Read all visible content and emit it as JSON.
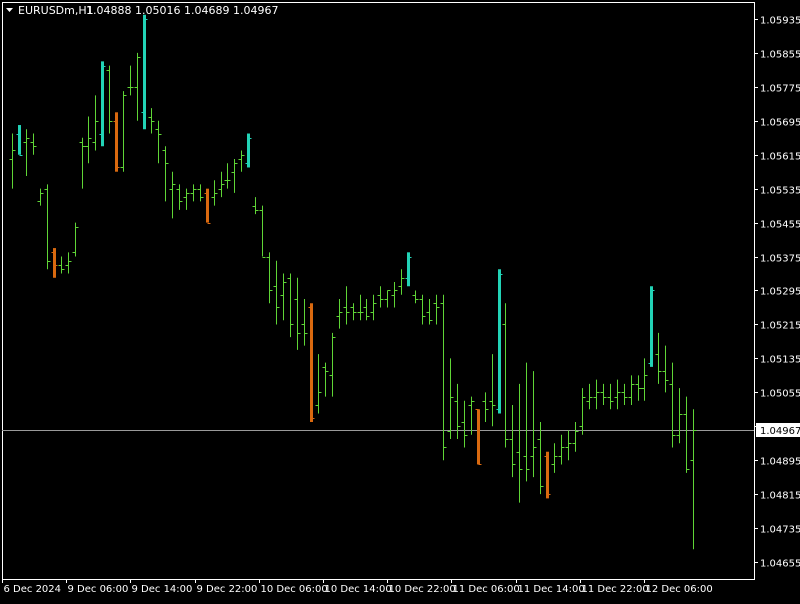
{
  "header": {
    "symbol": "EURUSDm,H1",
    "ohlc": "1.04888 1.05016 1.04689 1.04967"
  },
  "colors": {
    "background": "#000000",
    "frame": "#ffffff",
    "bar_normal": "#5fd536",
    "bar_up_highlight": "#22d3b6",
    "bar_down_highlight": "#d9690f",
    "bid_line": "#9a9a9a",
    "bid_label_bg": "#ffffff"
  },
  "chart_data": {
    "type": "ohlc-bar",
    "symbol": "EURUSDm",
    "timeframe": "H1",
    "ylim": [
      1.04615,
      1.05975
    ],
    "y_ticks": [
      "1.05935",
      "1.05855",
      "1.05775",
      "1.05695",
      "1.05615",
      "1.05535",
      "1.05455",
      "1.05375",
      "1.05295",
      "1.05215",
      "1.05135",
      "1.05055",
      "1.04975",
      "1.04895",
      "1.04815",
      "1.04735",
      "1.04655"
    ],
    "x_ticks": [
      "6 Dec 2024",
      "9 Dec 06:00",
      "9 Dec 14:00",
      "9 Dec 22:00",
      "10 Dec 06:00",
      "10 Dec 14:00",
      "10 Dec 22:00",
      "11 Dec 06:00",
      "11 Dec 14:00",
      "11 Dec 22:00",
      "12 Dec 06:00"
    ],
    "bid": "1.04967",
    "bars": [
      {
        "o": 1.05605,
        "h": 1.05665,
        "l": 1.05535,
        "c": 1.05625,
        "hl": 0
      },
      {
        "o": 1.05665,
        "h": 1.05685,
        "l": 1.05615,
        "c": 1.05615,
        "hl": 1
      },
      {
        "o": 1.05645,
        "h": 1.05675,
        "l": 1.05565,
        "c": 1.05655,
        "hl": 0
      },
      {
        "o": 1.05645,
        "h": 1.05665,
        "l": 1.05615,
        "c": 1.05635,
        "hl": 0
      },
      {
        "o": 1.05505,
        "h": 1.05535,
        "l": 1.05495,
        "c": 1.05525,
        "hl": 0
      },
      {
        "o": 1.05535,
        "h": 1.05545,
        "l": 1.05345,
        "c": 1.05365,
        "hl": 0
      },
      {
        "o": 1.05385,
        "h": 1.05395,
        "l": 1.05325,
        "c": 1.05355,
        "hl": 2
      },
      {
        "o": 1.05355,
        "h": 1.05375,
        "l": 1.05335,
        "c": 1.05345,
        "hl": 0
      },
      {
        "o": 1.05355,
        "h": 1.05385,
        "l": 1.05335,
        "c": 1.05365,
        "hl": 0
      },
      {
        "o": 1.05385,
        "h": 1.05455,
        "l": 1.05375,
        "c": 1.05445,
        "hl": 0
      },
      {
        "o": 1.05645,
        "h": 1.05655,
        "l": 1.05535,
        "c": 1.05635,
        "hl": 0
      },
      {
        "o": 1.05635,
        "h": 1.05705,
        "l": 1.05595,
        "c": 1.05655,
        "hl": 0
      },
      {
        "o": 1.05645,
        "h": 1.05755,
        "l": 1.05625,
        "c": 1.05695,
        "hl": 0
      },
      {
        "o": 1.05665,
        "h": 1.05835,
        "l": 1.05635,
        "c": 1.05825,
        "hl": 1
      },
      {
        "o": 1.05815,
        "h": 1.05825,
        "l": 1.05665,
        "c": 1.05695,
        "hl": 0
      },
      {
        "o": 1.05695,
        "h": 1.05715,
        "l": 1.05575,
        "c": 1.05585,
        "hl": 2
      },
      {
        "o": 1.05585,
        "h": 1.05765,
        "l": 1.05575,
        "c": 1.05755,
        "hl": 0
      },
      {
        "o": 1.05775,
        "h": 1.05825,
        "l": 1.05755,
        "c": 1.05775,
        "hl": 0
      },
      {
        "o": 1.05775,
        "h": 1.05855,
        "l": 1.05695,
        "c": 1.05845,
        "hl": 0
      },
      {
        "o": 1.05715,
        "h": 1.05945,
        "l": 1.05675,
        "c": 1.05935,
        "hl": 1
      },
      {
        "o": 1.05705,
        "h": 1.05725,
        "l": 1.05665,
        "c": 1.05695,
        "hl": 0
      },
      {
        "o": 1.05675,
        "h": 1.05695,
        "l": 1.05595,
        "c": 1.05665,
        "hl": 0
      },
      {
        "o": 1.05625,
        "h": 1.05635,
        "l": 1.05505,
        "c": 1.05595,
        "hl": 0
      },
      {
        "o": 1.05535,
        "h": 1.05575,
        "l": 1.05465,
        "c": 1.05545,
        "hl": 0
      },
      {
        "o": 1.05535,
        "h": 1.05545,
        "l": 1.05485,
        "c": 1.05505,
        "hl": 0
      },
      {
        "o": 1.05515,
        "h": 1.05535,
        "l": 1.05485,
        "c": 1.05525,
        "hl": 0
      },
      {
        "o": 1.05525,
        "h": 1.05545,
        "l": 1.05505,
        "c": 1.05535,
        "hl": 0
      },
      {
        "o": 1.05535,
        "h": 1.05545,
        "l": 1.05505,
        "c": 1.05515,
        "hl": 0
      },
      {
        "o": 1.05525,
        "h": 1.05535,
        "l": 1.05455,
        "c": 1.05455,
        "hl": 2
      },
      {
        "o": 1.05515,
        "h": 1.05555,
        "l": 1.05495,
        "c": 1.05525,
        "hl": 0
      },
      {
        "o": 1.05535,
        "h": 1.05575,
        "l": 1.05515,
        "c": 1.05545,
        "hl": 0
      },
      {
        "o": 1.05555,
        "h": 1.05595,
        "l": 1.05535,
        "c": 1.05555,
        "hl": 0
      },
      {
        "o": 1.05575,
        "h": 1.05605,
        "l": 1.05525,
        "c": 1.05595,
        "hl": 0
      },
      {
        "o": 1.05605,
        "h": 1.05625,
        "l": 1.05575,
        "c": 1.05615,
        "hl": 0
      },
      {
        "o": 1.05595,
        "h": 1.05665,
        "l": 1.05585,
        "c": 1.05655,
        "hl": 1
      },
      {
        "o": 1.05495,
        "h": 1.05515,
        "l": 1.05475,
        "c": 1.05485,
        "hl": 0
      },
      {
        "o": 1.05485,
        "h": 1.05495,
        "l": 1.05375,
        "c": 1.05375,
        "hl": 0
      },
      {
        "o": 1.05375,
        "h": 1.05385,
        "l": 1.05265,
        "c": 1.05295,
        "hl": 0
      },
      {
        "o": 1.05305,
        "h": 1.05365,
        "l": 1.05215,
        "c": 1.05255,
        "hl": 0
      },
      {
        "o": 1.05285,
        "h": 1.05335,
        "l": 1.05225,
        "c": 1.05315,
        "hl": 0
      },
      {
        "o": 1.05325,
        "h": 1.05335,
        "l": 1.05185,
        "c": 1.05215,
        "hl": 0
      },
      {
        "o": 1.05275,
        "h": 1.05325,
        "l": 1.05155,
        "c": 1.05195,
        "hl": 0
      },
      {
        "o": 1.05215,
        "h": 1.05275,
        "l": 1.05165,
        "c": 1.05195,
        "hl": 0
      },
      {
        "o": 1.05255,
        "h": 1.05265,
        "l": 1.04985,
        "c": 1.04995,
        "hl": 2
      },
      {
        "o": 1.05025,
        "h": 1.05145,
        "l": 1.05005,
        "c": 1.05055,
        "hl": 0
      },
      {
        "o": 1.05115,
        "h": 1.05125,
        "l": 1.05045,
        "c": 1.05105,
        "hl": 0
      },
      {
        "o": 1.05095,
        "h": 1.05195,
        "l": 1.05045,
        "c": 1.05185,
        "hl": 0
      },
      {
        "o": 1.05235,
        "h": 1.05275,
        "l": 1.05205,
        "c": 1.05245,
        "hl": 0
      },
      {
        "o": 1.05255,
        "h": 1.05305,
        "l": 1.05215,
        "c": 1.05245,
        "hl": 0
      },
      {
        "o": 1.05255,
        "h": 1.05265,
        "l": 1.05225,
        "c": 1.05245,
        "hl": 0
      },
      {
        "o": 1.05245,
        "h": 1.05285,
        "l": 1.05225,
        "c": 1.05245,
        "hl": 0
      },
      {
        "o": 1.05255,
        "h": 1.05275,
        "l": 1.05225,
        "c": 1.05235,
        "hl": 0
      },
      {
        "o": 1.05245,
        "h": 1.05285,
        "l": 1.05225,
        "c": 1.05265,
        "hl": 0
      },
      {
        "o": 1.05285,
        "h": 1.05305,
        "l": 1.05255,
        "c": 1.05275,
        "hl": 0
      },
      {
        "o": 1.05275,
        "h": 1.05295,
        "l": 1.05255,
        "c": 1.05295,
        "hl": 0
      },
      {
        "o": 1.05285,
        "h": 1.05315,
        "l": 1.05255,
        "c": 1.05295,
        "hl": 0
      },
      {
        "o": 1.05305,
        "h": 1.05345,
        "l": 1.05285,
        "c": 1.05325,
        "hl": 0
      },
      {
        "o": 1.05325,
        "h": 1.05385,
        "l": 1.05305,
        "c": 1.05375,
        "hl": 1
      },
      {
        "o": 1.05285,
        "h": 1.05295,
        "l": 1.05265,
        "c": 1.05275,
        "hl": 0
      },
      {
        "o": 1.05275,
        "h": 1.05285,
        "l": 1.05215,
        "c": 1.05235,
        "hl": 0
      },
      {
        "o": 1.05245,
        "h": 1.05275,
        "l": 1.05215,
        "c": 1.05225,
        "hl": 0
      },
      {
        "o": 1.05265,
        "h": 1.05285,
        "l": 1.05215,
        "c": 1.05255,
        "hl": 0
      },
      {
        "o": 1.05265,
        "h": 1.05285,
        "l": 1.04895,
        "c": 1.04925,
        "hl": 0
      },
      {
        "o": 1.04965,
        "h": 1.05135,
        "l": 1.04945,
        "c": 1.05045,
        "hl": 0
      },
      {
        "o": 1.05035,
        "h": 1.05075,
        "l": 1.04945,
        "c": 1.04975,
        "hl": 0
      },
      {
        "o": 1.04985,
        "h": 1.05035,
        "l": 1.04925,
        "c": 1.04955,
        "hl": 0
      },
      {
        "o": 1.05025,
        "h": 1.05045,
        "l": 1.04955,
        "c": 1.05035,
        "hl": 0
      },
      {
        "o": 1.05015,
        "h": 1.05015,
        "l": 1.04885,
        "c": 1.04885,
        "hl": 2
      },
      {
        "o": 1.05035,
        "h": 1.05055,
        "l": 1.04985,
        "c": 1.05015,
        "hl": 0
      },
      {
        "o": 1.05035,
        "h": 1.05145,
        "l": 1.04975,
        "c": 1.05025,
        "hl": 0
      },
      {
        "o": 1.05015,
        "h": 1.05345,
        "l": 1.05005,
        "c": 1.05335,
        "hl": 1
      },
      {
        "o": 1.05215,
        "h": 1.05265,
        "l": 1.04925,
        "c": 1.04945,
        "hl": 0
      },
      {
        "o": 1.04945,
        "h": 1.05025,
        "l": 1.04855,
        "c": 1.04885,
        "hl": 0
      },
      {
        "o": 1.04915,
        "h": 1.05075,
        "l": 1.04795,
        "c": 1.04875,
        "hl": 0
      },
      {
        "o": 1.04905,
        "h": 1.05125,
        "l": 1.04845,
        "c": 1.04875,
        "hl": 0
      },
      {
        "o": 1.04905,
        "h": 1.05105,
        "l": 1.04855,
        "c": 1.04925,
        "hl": 0
      },
      {
        "o": 1.04945,
        "h": 1.04985,
        "l": 1.04815,
        "c": 1.04835,
        "hl": 0
      },
      {
        "o": 1.04905,
        "h": 1.04915,
        "l": 1.04805,
        "c": 1.04815,
        "hl": 2
      },
      {
        "o": 1.04885,
        "h": 1.04935,
        "l": 1.04865,
        "c": 1.04905,
        "hl": 0
      },
      {
        "o": 1.04905,
        "h": 1.04955,
        "l": 1.04885,
        "c": 1.04925,
        "hl": 0
      },
      {
        "o": 1.04925,
        "h": 1.04965,
        "l": 1.04895,
        "c": 1.04935,
        "hl": 0
      },
      {
        "o": 1.04935,
        "h": 1.04985,
        "l": 1.04915,
        "c": 1.04965,
        "hl": 0
      },
      {
        "o": 1.04975,
        "h": 1.05065,
        "l": 1.04955,
        "c": 1.05045,
        "hl": 0
      },
      {
        "o": 1.05035,
        "h": 1.05075,
        "l": 1.05015,
        "c": 1.05045,
        "hl": 0
      },
      {
        "o": 1.05045,
        "h": 1.05085,
        "l": 1.05015,
        "c": 1.05055,
        "hl": 0
      },
      {
        "o": 1.05055,
        "h": 1.05075,
        "l": 1.05025,
        "c": 1.05045,
        "hl": 0
      },
      {
        "o": 1.05045,
        "h": 1.05075,
        "l": 1.05015,
        "c": 1.05035,
        "hl": 0
      },
      {
        "o": 1.05045,
        "h": 1.05085,
        "l": 1.05015,
        "c": 1.05055,
        "hl": 0
      },
      {
        "o": 1.05055,
        "h": 1.05075,
        "l": 1.05025,
        "c": 1.05045,
        "hl": 0
      },
      {
        "o": 1.05045,
        "h": 1.05095,
        "l": 1.05025,
        "c": 1.05075,
        "hl": 0
      },
      {
        "o": 1.05075,
        "h": 1.05095,
        "l": 1.05035,
        "c": 1.05065,
        "hl": 0
      },
      {
        "o": 1.05065,
        "h": 1.05135,
        "l": 1.05035,
        "c": 1.05095,
        "hl": 0
      },
      {
        "o": 1.05125,
        "h": 1.05305,
        "l": 1.05115,
        "c": 1.05295,
        "hl": 1
      },
      {
        "o": 1.05145,
        "h": 1.05195,
        "l": 1.05075,
        "c": 1.05105,
        "hl": 0
      },
      {
        "o": 1.05105,
        "h": 1.05165,
        "l": 1.05055,
        "c": 1.05085,
        "hl": 0
      },
      {
        "o": 1.05075,
        "h": 1.05125,
        "l": 1.04925,
        "c": 1.04955,
        "hl": 0
      },
      {
        "o": 1.04955,
        "h": 1.05065,
        "l": 1.04935,
        "c": 1.05005,
        "hl": 0
      },
      {
        "o": 1.05005,
        "h": 1.05045,
        "l": 1.04865,
        "c": 1.04875,
        "hl": 0
      },
      {
        "o": 1.04895,
        "h": 1.05015,
        "l": 1.04685,
        "c": 1.04967,
        "hl": 0
      }
    ]
  }
}
